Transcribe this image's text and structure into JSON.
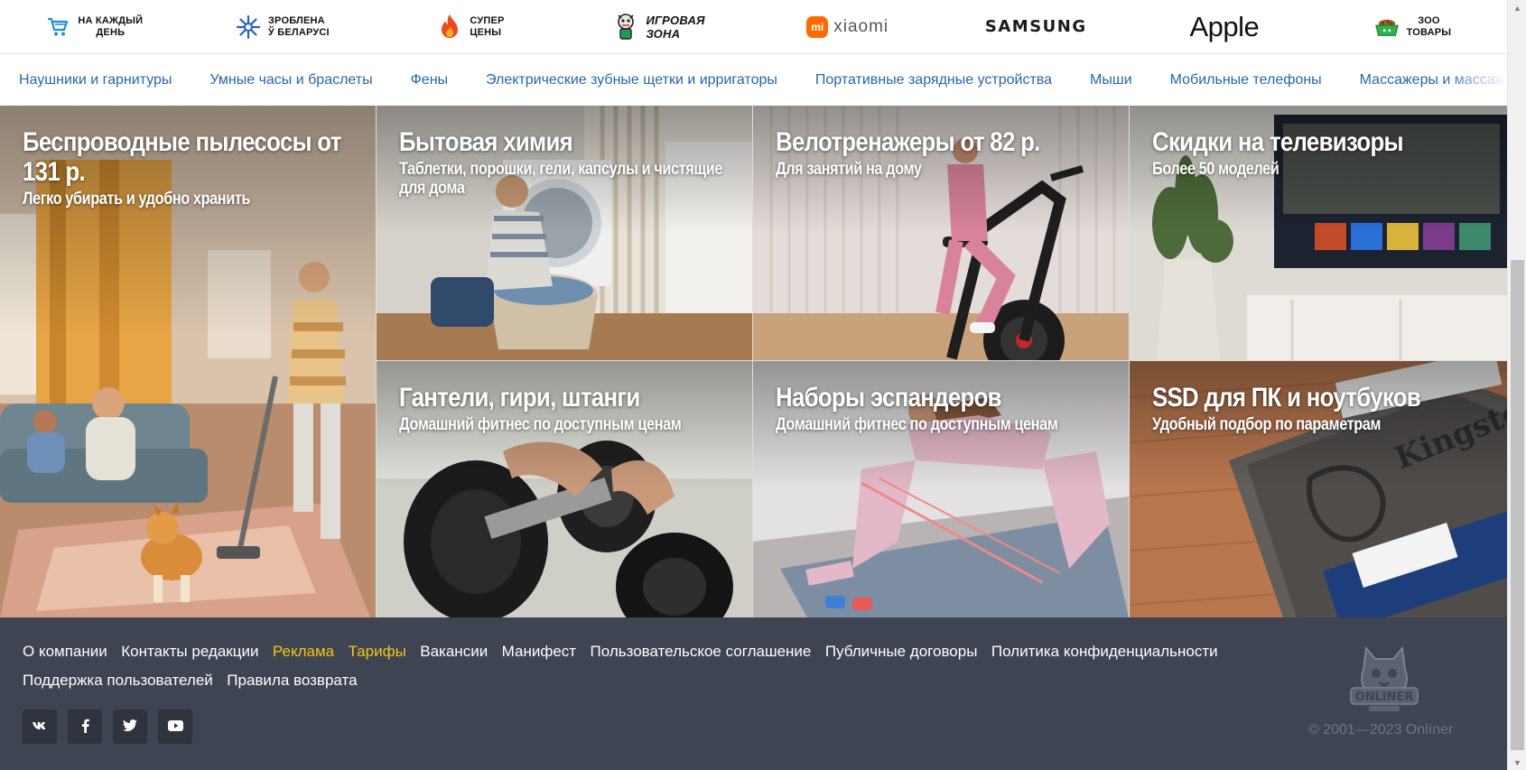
{
  "brands": [
    {
      "id": "daily",
      "lines": [
        "НА КАЖДЫЙ",
        "ДЕНЬ"
      ],
      "icon": "shopping-cart-icon",
      "color": "#1a8fd6"
    },
    {
      "id": "belarus",
      "lines": [
        "ЗРОБЛЕНА",
        "Ў БЕЛАРУСІ"
      ],
      "icon": "snowflake-icon",
      "color": "#2a5fc2"
    },
    {
      "id": "super",
      "lines": [
        "СУПЕР",
        "ЦЕНЫ"
      ],
      "icon": "flame-icon",
      "color": "#f0481d"
    },
    {
      "id": "gaming",
      "lines": [
        "ИГРОВАЯ",
        "ЗОНА"
      ],
      "icon": "gamer-mascot-icon",
      "color": "#1d9a5a"
    },
    {
      "id": "xiaomi",
      "mark": "mi",
      "word": "xiaomi",
      "color": "#ff6a00"
    },
    {
      "id": "samsung",
      "word": "SAMSUNG"
    },
    {
      "id": "apple",
      "word": "Apple"
    },
    {
      "id": "zoo",
      "lines": [
        "ЗОО",
        "ТОВАРЫ"
      ],
      "icon": "pet-food-bowl-icon",
      "color": "#2fb54a"
    }
  ],
  "categories": [
    "Наушники и гарнитуры",
    "Умные часы и браслеты",
    "Фены",
    "Электрические зубные щетки и ирригаторы",
    "Портативные зарядные устройства",
    "Мыши",
    "Мобильные телефоны",
    "Массажеры и массажные"
  ],
  "tiles": [
    {
      "title": "Беспроводные пылесосы от 131 р.",
      "subtitle": "Легко убирать и удобно хранить"
    },
    {
      "title": "Бытовая химия",
      "subtitle": "Таблетки, порошки, гели, капсулы и чистящие для дома"
    },
    {
      "title": "Велотренажеры от 82 р.",
      "subtitle": "Для занятий на дому"
    },
    {
      "title": "Скидки на телевизоры",
      "subtitle": "Более 50 моделей"
    },
    {
      "title": "Гантели, гири, штанги",
      "subtitle": "Домашний фитнес по доступным ценам"
    },
    {
      "title": "Наборы эспандеров",
      "subtitle": "Домашний фитнес по доступным ценам"
    },
    {
      "title": "SSD для ПК и ноутбуков",
      "subtitle": "Удобный подбор по параметрам"
    }
  ],
  "footer": {
    "links": [
      {
        "label": "О компании",
        "accent": false
      },
      {
        "label": "Контакты редакции",
        "accent": false
      },
      {
        "label": "Реклама",
        "accent": true
      },
      {
        "label": "Тарифы",
        "accent": true
      },
      {
        "label": "Вакансии",
        "accent": false
      },
      {
        "label": "Манифест",
        "accent": false
      },
      {
        "label": "Пользовательское соглашение",
        "accent": false
      },
      {
        "label": "Публичные договоры",
        "accent": false
      },
      {
        "label": "Политика конфиденциальности",
        "accent": false
      },
      {
        "label": "Поддержка пользователей",
        "accent": false
      },
      {
        "label": "Правила возврата",
        "accent": false
      }
    ],
    "socials": [
      {
        "name": "vk",
        "label": "vk",
        "icon": "vk-icon"
      },
      {
        "name": "facebook",
        "label": "f",
        "icon": "facebook-icon"
      },
      {
        "name": "twitter",
        "label": "twitter",
        "icon": "twitter-icon"
      },
      {
        "name": "youtube",
        "label": "youtube",
        "icon": "youtube-icon"
      }
    ],
    "logo_text": "ONLINER",
    "copyright": "© 2001—2023 Onlíner",
    "accent_color": "#f5c518",
    "background": "#3e4451"
  }
}
